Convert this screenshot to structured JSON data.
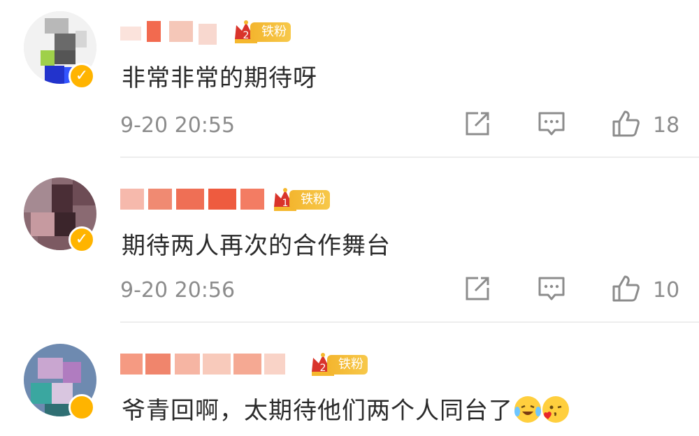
{
  "comments": [
    {
      "text": "非常非常的期待呀",
      "time": "9-20 20:55",
      "likes": "18",
      "badge": {
        "level": "2",
        "label": "铁粉"
      },
      "verified": true
    },
    {
      "text": "期待两人再次的合作舞台",
      "time": "9-20 20:56",
      "likes": "10",
      "badge": {
        "level": "1",
        "label": "铁粉"
      },
      "verified": true
    },
    {
      "text": "爷青回啊，太期待他们两个人同台了",
      "time": "",
      "likes": "",
      "badge": {
        "level": "2",
        "label": "铁粉"
      },
      "verified": false,
      "emojis": [
        "tears-of-joy-emoji",
        "heart-kiss-emoji"
      ]
    }
  ],
  "icons": {
    "share": "share-icon",
    "reply": "comment-icon",
    "like": "thumbs-up-icon",
    "verified": "verified-badge-icon",
    "crown": "crown-icon"
  },
  "colors": {
    "badge": "#f3b52e",
    "badge_crown": "#d9342b",
    "verified": "#ffb400",
    "meta_text": "#8c8c8c",
    "body_text": "#2b2b2b",
    "divider": "#ededed"
  }
}
